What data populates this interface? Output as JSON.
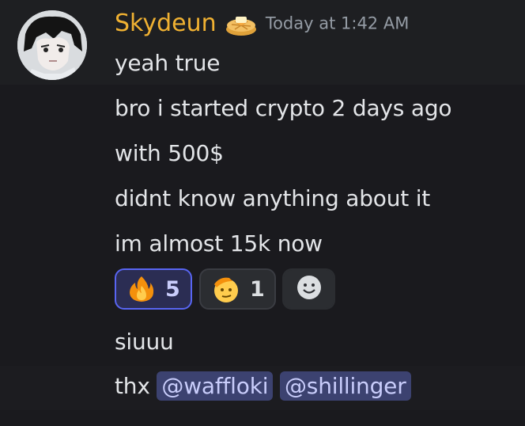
{
  "message": {
    "username": "Skydeun",
    "badge_icon": "waffle-icon",
    "timestamp": "Today at 1:42 AM",
    "lines": [
      "yeah true",
      "bro i started crypto 2 days ago",
      "with 500$",
      "didnt know anything about it",
      "im almost 15k now"
    ]
  },
  "reactions": [
    {
      "emoji": "fire-icon",
      "count": "5",
      "active": true
    },
    {
      "emoji": "saluting-face-icon",
      "count": "1",
      "active": false
    },
    {
      "emoji": "add-reaction-icon"
    }
  ],
  "followups": {
    "line1": "siuuu",
    "line2_prefix": "thx",
    "mentions": [
      "@waffloki",
      "@shillinger"
    ]
  },
  "colors": {
    "username": "#f0b132",
    "mention_bg": "#3c4270",
    "mention_text": "#c9cdfb",
    "active_reaction_border": "#5865f2"
  }
}
